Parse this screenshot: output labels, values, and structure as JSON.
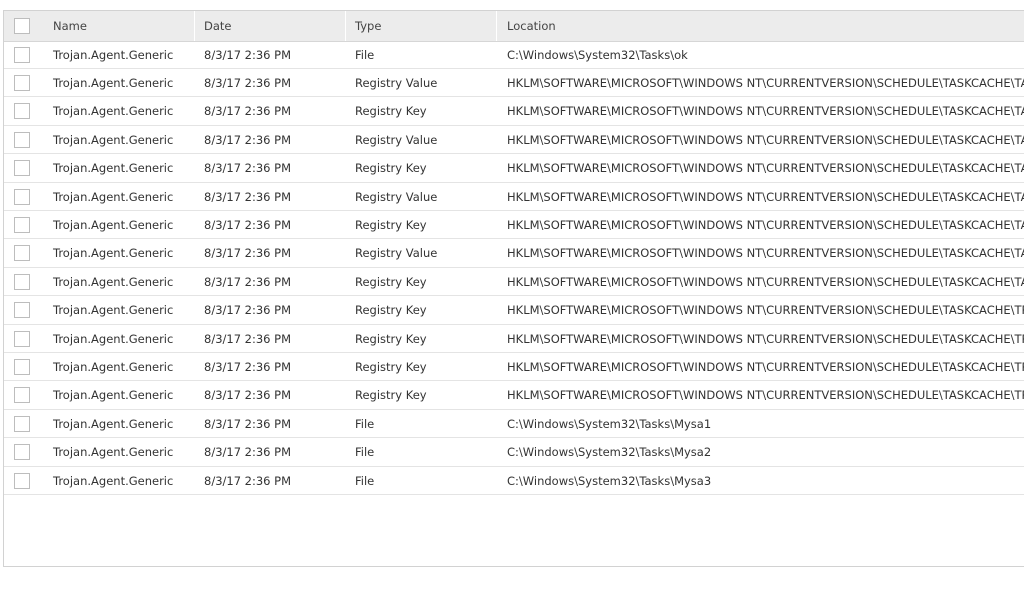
{
  "columns": {
    "name": "Name",
    "date": "Date",
    "type": "Type",
    "location": "Location"
  },
  "rows": [
    {
      "name": "Trojan.Agent.Generic",
      "date": "8/3/17 2:36 PM",
      "type": "File",
      "location": "C:\\Windows\\System32\\Tasks\\ok"
    },
    {
      "name": "Trojan.Agent.Generic",
      "date": "8/3/17 2:36 PM",
      "type": "Registry Value",
      "location": "HKLM\\SOFTWARE\\MICROSOFT\\WINDOWS NT\\CURRENTVERSION\\SCHEDULE\\TASKCACHE\\TASKS\\{"
    },
    {
      "name": "Trojan.Agent.Generic",
      "date": "8/3/17 2:36 PM",
      "type": "Registry Key",
      "location": "HKLM\\SOFTWARE\\MICROSOFT\\WINDOWS NT\\CURRENTVERSION\\SCHEDULE\\TASKCACHE\\TASKS\\{"
    },
    {
      "name": "Trojan.Agent.Generic",
      "date": "8/3/17 2:36 PM",
      "type": "Registry Value",
      "location": "HKLM\\SOFTWARE\\MICROSOFT\\WINDOWS NT\\CURRENTVERSION\\SCHEDULE\\TASKCACHE\\TASKS\\{"
    },
    {
      "name": "Trojan.Agent.Generic",
      "date": "8/3/17 2:36 PM",
      "type": "Registry Key",
      "location": "HKLM\\SOFTWARE\\MICROSOFT\\WINDOWS NT\\CURRENTVERSION\\SCHEDULE\\TASKCACHE\\TASKS\\{"
    },
    {
      "name": "Trojan.Agent.Generic",
      "date": "8/3/17 2:36 PM",
      "type": "Registry Value",
      "location": "HKLM\\SOFTWARE\\MICROSOFT\\WINDOWS NT\\CURRENTVERSION\\SCHEDULE\\TASKCACHE\\TASKS\\{"
    },
    {
      "name": "Trojan.Agent.Generic",
      "date": "8/3/17 2:36 PM",
      "type": "Registry Key",
      "location": "HKLM\\SOFTWARE\\MICROSOFT\\WINDOWS NT\\CURRENTVERSION\\SCHEDULE\\TASKCACHE\\TASKS\\{"
    },
    {
      "name": "Trojan.Agent.Generic",
      "date": "8/3/17 2:36 PM",
      "type": "Registry Value",
      "location": "HKLM\\SOFTWARE\\MICROSOFT\\WINDOWS NT\\CURRENTVERSION\\SCHEDULE\\TASKCACHE\\TASKS\\{"
    },
    {
      "name": "Trojan.Agent.Generic",
      "date": "8/3/17 2:36 PM",
      "type": "Registry Key",
      "location": "HKLM\\SOFTWARE\\MICROSOFT\\WINDOWS NT\\CURRENTVERSION\\SCHEDULE\\TASKCACHE\\TASKS\\{"
    },
    {
      "name": "Trojan.Agent.Generic",
      "date": "8/3/17 2:36 PM",
      "type": "Registry Key",
      "location": "HKLM\\SOFTWARE\\MICROSOFT\\WINDOWS NT\\CURRENTVERSION\\SCHEDULE\\TASKCACHE\\TREE\\MY"
    },
    {
      "name": "Trojan.Agent.Generic",
      "date": "8/3/17 2:36 PM",
      "type": "Registry Key",
      "location": "HKLM\\SOFTWARE\\MICROSOFT\\WINDOWS NT\\CURRENTVERSION\\SCHEDULE\\TASKCACHE\\TREE\\MY"
    },
    {
      "name": "Trojan.Agent.Generic",
      "date": "8/3/17 2:36 PM",
      "type": "Registry Key",
      "location": "HKLM\\SOFTWARE\\MICROSOFT\\WINDOWS NT\\CURRENTVERSION\\SCHEDULE\\TASKCACHE\\TREE\\MY"
    },
    {
      "name": "Trojan.Agent.Generic",
      "date": "8/3/17 2:36 PM",
      "type": "Registry Key",
      "location": "HKLM\\SOFTWARE\\MICROSOFT\\WINDOWS NT\\CURRENTVERSION\\SCHEDULE\\TASKCACHE\\TREE\\OK"
    },
    {
      "name": "Trojan.Agent.Generic",
      "date": "8/3/17 2:36 PM",
      "type": "File",
      "location": "C:\\Windows\\System32\\Tasks\\Mysa1"
    },
    {
      "name": "Trojan.Agent.Generic",
      "date": "8/3/17 2:36 PM",
      "type": "File",
      "location": "C:\\Windows\\System32\\Tasks\\Mysa2"
    },
    {
      "name": "Trojan.Agent.Generic",
      "date": "8/3/17 2:36 PM",
      "type": "File",
      "location": "C:\\Windows\\System32\\Tasks\\Mysa3"
    }
  ]
}
